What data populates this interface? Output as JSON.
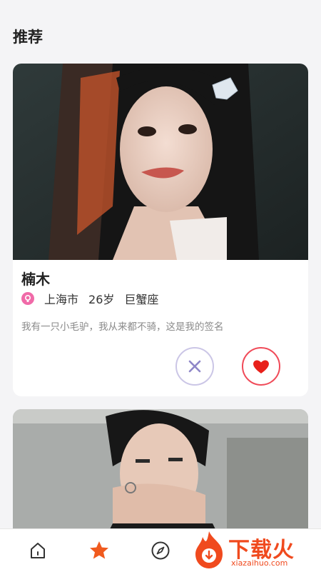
{
  "header": {
    "title": "推荐"
  },
  "cards": [
    {
      "name": "楠木",
      "city": "上海市",
      "age": "26岁",
      "zodiac": "巨蟹座",
      "signature": "我有一只小毛驴，我从来都不骑，这是我的签名",
      "photo_desc": "portrait-woman-long-hair-butterfly-clip",
      "actions": {
        "skip_icon": "close-icon",
        "like_icon": "heart-icon"
      }
    },
    {
      "photo_desc": "portrait-young-man-hand-on-chin"
    }
  ],
  "tabbar": {
    "items": [
      {
        "icon": "home-icon",
        "active": false
      },
      {
        "icon": "star-icon",
        "active": true
      },
      {
        "icon": "compass-icon",
        "active": false
      }
    ]
  },
  "watermark": {
    "text": "下载火",
    "sub": "xiazaihuo.com"
  },
  "colors": {
    "accent": "#f04a58",
    "tab_active": "#f05a1e",
    "badge": "#f06aa8",
    "skip_border": "#cbc6e6"
  }
}
